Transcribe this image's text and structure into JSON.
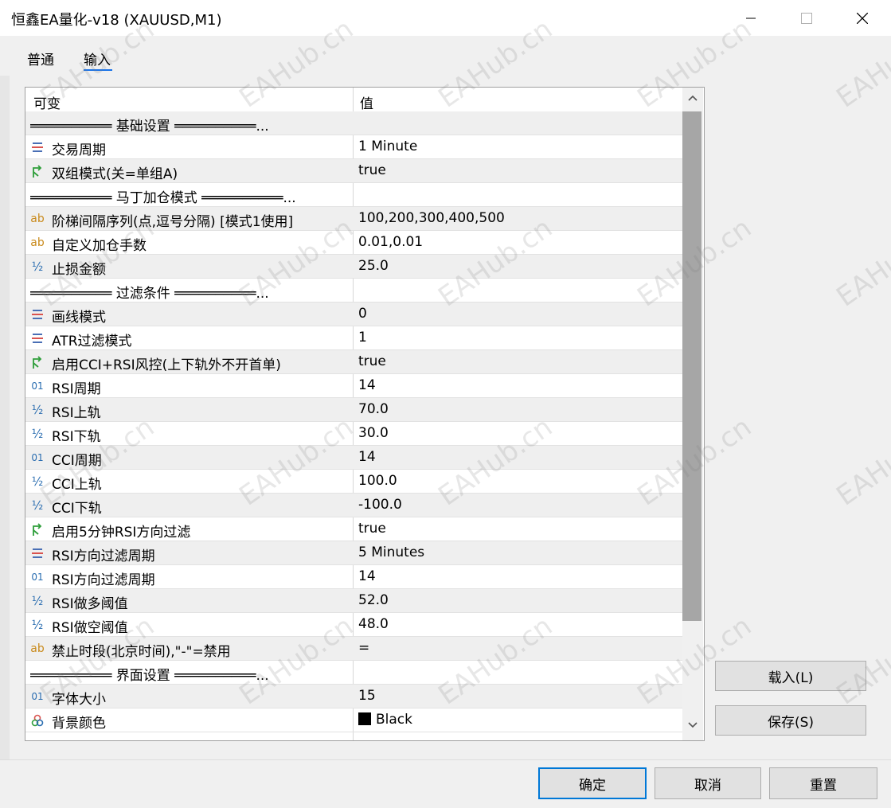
{
  "window": {
    "title": "恒鑫EA量化-v18 (XAUUSD,M1)"
  },
  "tabs": {
    "general": "普通",
    "inputs": "输入"
  },
  "grid": {
    "header_name": "可变",
    "header_value": "值",
    "rows": [
      {
        "type": "section",
        "name": "══════════ 基础设置 ══════════...",
        "value": ""
      },
      {
        "type": "enum",
        "icon": "enum-icon",
        "name": "交易周期",
        "value": "1 Minute"
      },
      {
        "type": "bool",
        "icon": "bool-icon",
        "name": "双组模式(关=单组A)",
        "value": "true"
      },
      {
        "type": "section",
        "name": "══════════ 马丁加仓模式 ══════════...",
        "value": ""
      },
      {
        "type": "string",
        "icon": "string-icon",
        "name": "阶梯间隔序列(点,逗号分隔) [模式1使用]",
        "value": "100,200,300,400,500"
      },
      {
        "type": "string",
        "icon": "string-icon",
        "name": "自定义加仓手数",
        "value": "0.01,0.01"
      },
      {
        "type": "double",
        "icon": "double-icon",
        "name": "止损金额",
        "value": "25.0"
      },
      {
        "type": "section",
        "name": "══════════ 过滤条件 ══════════...",
        "value": ""
      },
      {
        "type": "enum",
        "icon": "enum-icon",
        "name": "画线模式",
        "value": "0"
      },
      {
        "type": "enum",
        "icon": "enum-icon",
        "name": "ATR过滤模式",
        "value": "1"
      },
      {
        "type": "bool",
        "icon": "bool-icon",
        "name": "启用CCI+RSI风控(上下轨外不开首单)",
        "value": "true"
      },
      {
        "type": "int",
        "icon": "int-icon",
        "name": "RSI周期",
        "value": "14"
      },
      {
        "type": "double",
        "icon": "double-icon",
        "name": "RSI上轨",
        "value": "70.0"
      },
      {
        "type": "double",
        "icon": "double-icon",
        "name": "RSI下轨",
        "value": "30.0"
      },
      {
        "type": "int",
        "icon": "int-icon",
        "name": "CCI周期",
        "value": "14"
      },
      {
        "type": "double",
        "icon": "double-icon",
        "name": "CCI上轨",
        "value": "100.0"
      },
      {
        "type": "double",
        "icon": "double-icon",
        "name": "CCI下轨",
        "value": "-100.0"
      },
      {
        "type": "bool",
        "icon": "bool-icon",
        "name": "启用5分钟RSI方向过滤",
        "value": "true"
      },
      {
        "type": "enum",
        "icon": "enum-icon",
        "name": "RSI方向过滤周期",
        "value": "5 Minutes"
      },
      {
        "type": "int",
        "icon": "int-icon",
        "name": "RSI方向过滤周期",
        "value": "14"
      },
      {
        "type": "double",
        "icon": "double-icon",
        "name": "RSI做多阈值",
        "value": "52.0"
      },
      {
        "type": "double",
        "icon": "double-icon",
        "name": "RSI做空阈值",
        "value": "48.0"
      },
      {
        "type": "string",
        "icon": "string-icon",
        "name": "禁止时段(北京时间),\"-\"=禁用",
        "value": "="
      },
      {
        "type": "section",
        "name": "══════════ 界面设置 ══════════...",
        "value": ""
      },
      {
        "type": "int",
        "icon": "int-icon",
        "name": "字体大小",
        "value": "15"
      },
      {
        "type": "color",
        "icon": "color-icon",
        "name": "背景颜色",
        "value": "Black"
      }
    ]
  },
  "buttons": {
    "load": "载入(L)",
    "save": "保存(S)",
    "ok": "确定",
    "cancel": "取消",
    "reset": "重置"
  },
  "watermark_text": "EAHub.cn",
  "colors": {
    "accent": "#0078d7",
    "tab_underline": "#1a73e8"
  }
}
